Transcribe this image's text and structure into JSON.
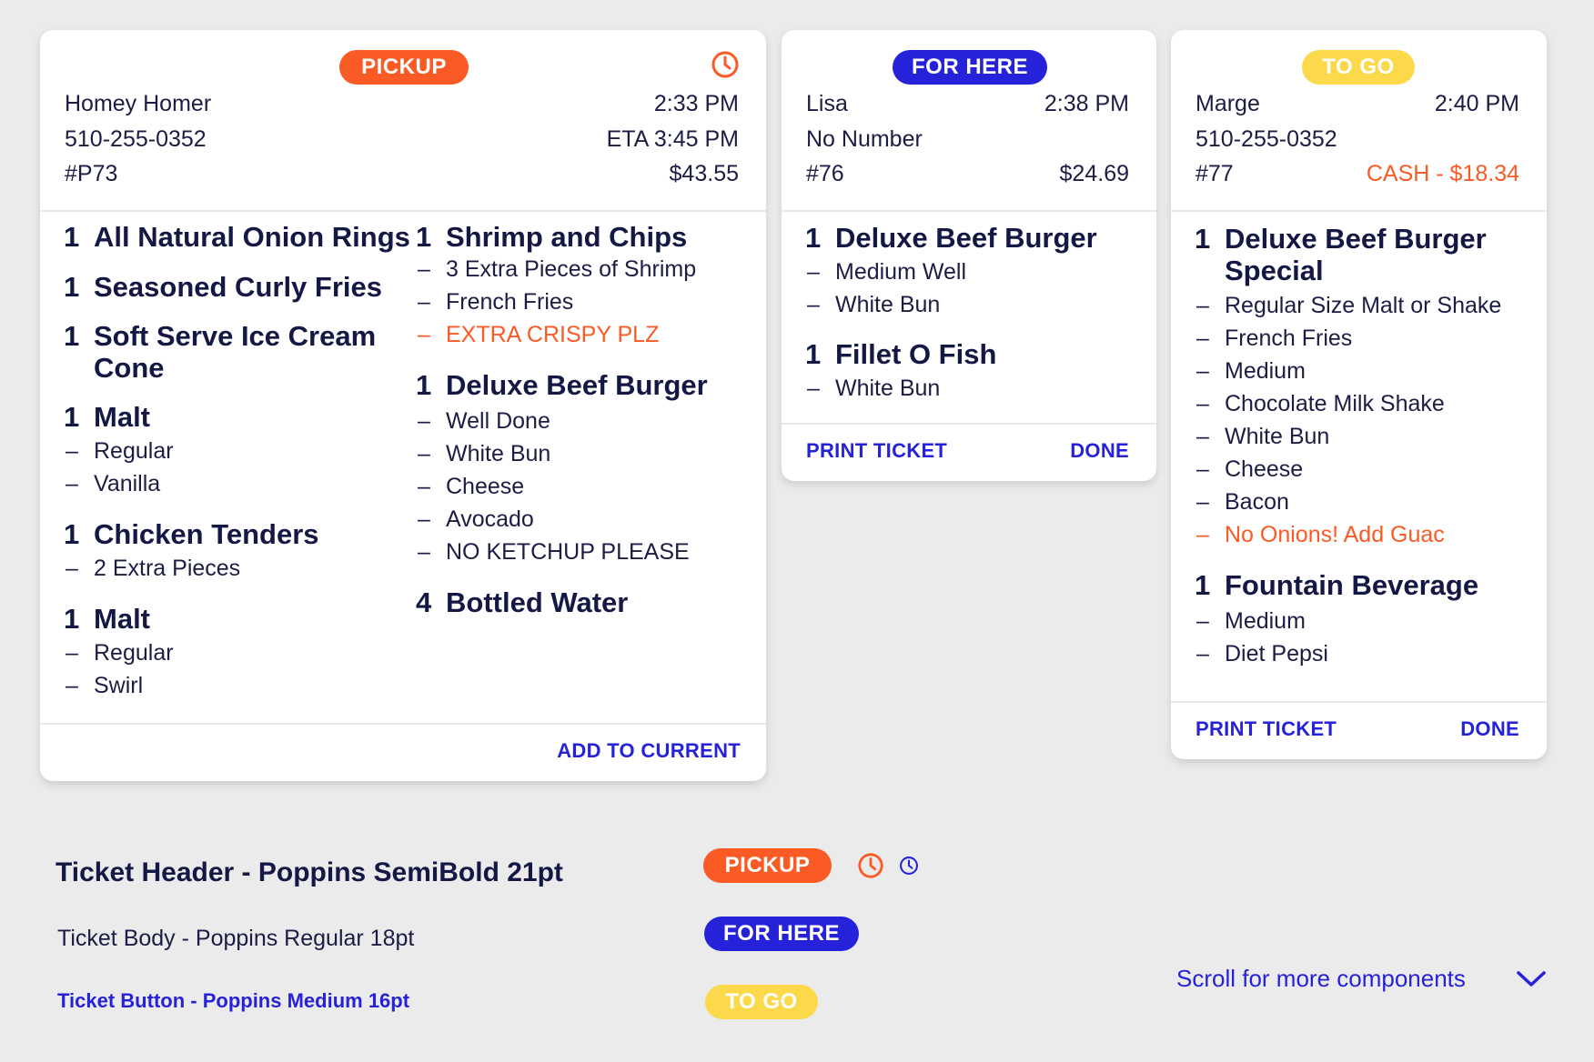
{
  "tickets": [
    {
      "type": "PICKUP",
      "name": "Homey Homer",
      "phone": "510-255-0352",
      "number": "#P73",
      "time": "2:33 PM",
      "eta": "ETA 3:45 PM",
      "total": "$43.55",
      "col1": [
        {
          "qty": "1",
          "name": "All Natural Onion Rings",
          "mods": []
        },
        {
          "qty": "1",
          "name": "Seasoned Curly Fries",
          "mods": []
        },
        {
          "qty": "1",
          "name": "Soft Serve Ice Cream Cone",
          "mods": []
        },
        {
          "qty": "1",
          "name": "Malt",
          "mods": [
            {
              "text": "Regular"
            },
            {
              "text": "Vanilla"
            }
          ]
        },
        {
          "qty": "1",
          "name": "Chicken Tenders",
          "mods": [
            {
              "text": "2 Extra Pieces"
            }
          ]
        },
        {
          "qty": "1",
          "name": "Malt",
          "mods": [
            {
              "text": "Regular"
            },
            {
              "text": "Swirl"
            }
          ]
        }
      ],
      "col2": [
        {
          "qty": "1",
          "name": "Shrimp and Chips",
          "mods": [
            {
              "text": "3 Extra Pieces of Shrimp"
            },
            {
              "text": "French Fries"
            },
            {
              "text": "EXTRA CRISPY PLZ",
              "note": true
            }
          ]
        },
        {
          "qty": "1",
          "name": "Deluxe Beef Burger",
          "mods": [
            {
              "text": "Well Done"
            },
            {
              "text": "White Bun"
            },
            {
              "text": "Cheese"
            },
            {
              "text": "Avocado"
            },
            {
              "text": "NO KETCHUP PLEASE"
            }
          ]
        },
        {
          "qty": "4",
          "name": "Bottled Water",
          "mods": []
        }
      ],
      "button": "ADD TO CURRENT"
    },
    {
      "type": "FOR HERE",
      "name": "Lisa",
      "phone": "No Number",
      "number": "#76",
      "time": "2:38 PM",
      "total": "$24.69",
      "items": [
        {
          "qty": "1",
          "name": "Deluxe Beef Burger",
          "mods": [
            {
              "text": "Medium Well"
            },
            {
              "text": "White Bun"
            }
          ]
        },
        {
          "qty": "1",
          "name": "Fillet O Fish",
          "mods": [
            {
              "text": "White Bun"
            }
          ]
        }
      ],
      "print": "PRINT TICKET",
      "done": "DONE"
    },
    {
      "type": "TO GO",
      "name": "Marge",
      "phone": "510-255-0352",
      "number": "#77",
      "time": "2:40 PM",
      "total": "CASH - $18.34",
      "items": [
        {
          "qty": "1",
          "name": "Deluxe Beef Burger Special",
          "mods": [
            {
              "text": "Regular Size Malt or Shake"
            },
            {
              "text": "French Fries"
            },
            {
              "text": "Medium"
            },
            {
              "text": "Chocolate Milk Shake"
            },
            {
              "text": "White Bun"
            },
            {
              "text": "Cheese"
            },
            {
              "text": "Bacon"
            },
            {
              "text": "No Onions! Add Guac",
              "note": true
            }
          ]
        },
        {
          "qty": "1",
          "name": "Fountain Beverage",
          "mods": [
            {
              "text": "Medium"
            },
            {
              "text": "Diet Pepsi"
            }
          ]
        }
      ],
      "print": "PRINT TICKET",
      "done": "DONE"
    }
  ],
  "legend": {
    "header": "Ticket Header - Poppins SemiBold 21pt",
    "body": "Ticket Body - Poppins Regular 18pt",
    "button": "Ticket Button - Poppins Medium 16pt",
    "badge_pickup": "PICKUP",
    "badge_here": "FOR HERE",
    "badge_togo": "TO GO",
    "scroll": "Scroll for more components"
  },
  "colors": {
    "pickup": "#fa5a24",
    "for_here": "#2622d9",
    "to_go": "#fcd94a",
    "text_dark": "#161a4e",
    "note": "#fa5a24",
    "button": "#2622d9",
    "background": "#ebebeb"
  },
  "icons": {
    "timer": "clock-icon",
    "scroll": "chevron-down-icon"
  }
}
